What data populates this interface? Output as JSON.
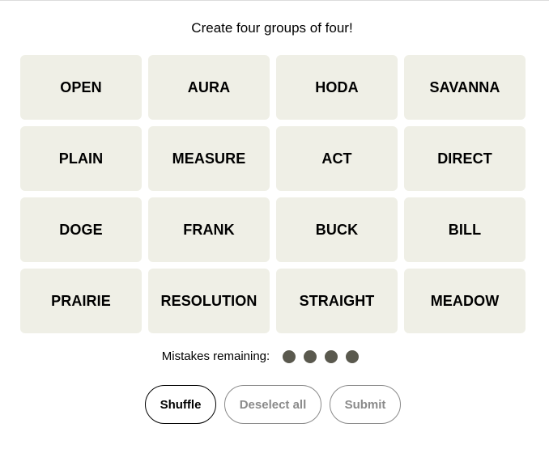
{
  "instructions": "Create four groups of four!",
  "board": {
    "tiles": [
      "OPEN",
      "AURA",
      "HODA",
      "SAVANNA",
      "PLAIN",
      "MEASURE",
      "ACT",
      "DIRECT",
      "DOGE",
      "FRANK",
      "BUCK",
      "BILL",
      "PRAIRIE",
      "RESOLUTION",
      "STRAIGHT",
      "MEADOW"
    ]
  },
  "mistakes": {
    "label": "Mistakes remaining:",
    "remaining": 4
  },
  "controls": {
    "shuffle_label": "Shuffle",
    "deselect_label": "Deselect all",
    "submit_label": "Submit"
  },
  "colors": {
    "tile_background": "#efefe6",
    "mistake_dot": "#5a594e",
    "disabled_button": "#8a8a8a"
  }
}
